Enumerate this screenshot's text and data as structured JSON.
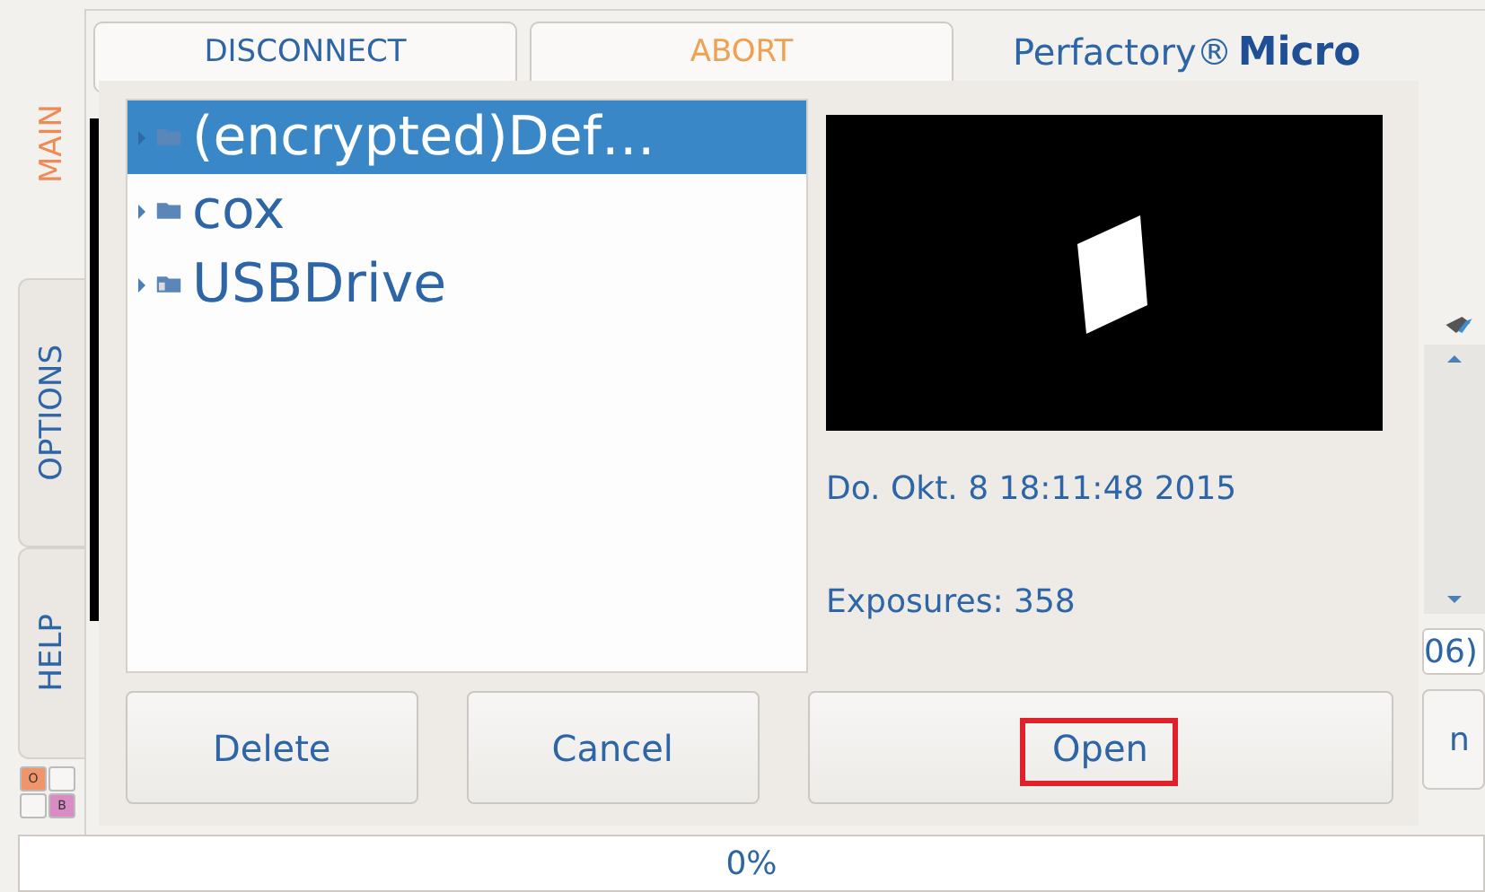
{
  "side_tabs": [
    {
      "label": "MAIN",
      "selected": true
    },
    {
      "label": "OPTIONS",
      "selected": false
    },
    {
      "label": "HELP",
      "selected": false
    }
  ],
  "color_keys": [
    {
      "label": "O",
      "color": "#f0956a"
    },
    {
      "color": "#f7f6f4"
    },
    {
      "color": "#f7f6f4"
    },
    {
      "label": "B",
      "color": "#d98bc4"
    }
  ],
  "toolbar": {
    "buttons": [
      {
        "label": "DISCONNECT",
        "kind": "normal"
      },
      {
        "label": "ABORT",
        "kind": "warning"
      }
    ],
    "logo": {
      "brand": "Perfactory®",
      "product": "Micro"
    }
  },
  "right_panel": {
    "field_text": "06)",
    "button_text": "n"
  },
  "dialog": {
    "tree": [
      {
        "label": "(encrypted)Def…",
        "selected": true,
        "kind": "folder"
      },
      {
        "label": "cox",
        "selected": false,
        "kind": "folder"
      },
      {
        "label": "USBDrive",
        "selected": false,
        "kind": "drive"
      }
    ],
    "date": "Do. Okt. 8 18:11:48 2015",
    "exposures": "Exposures: 358",
    "buttons": [
      {
        "label": "Delete",
        "highlighted": false
      },
      {
        "label": "Cancel",
        "highlighted": false
      },
      {
        "label": "Open",
        "highlighted": true
      }
    ]
  },
  "progress": {
    "text": "0%"
  }
}
